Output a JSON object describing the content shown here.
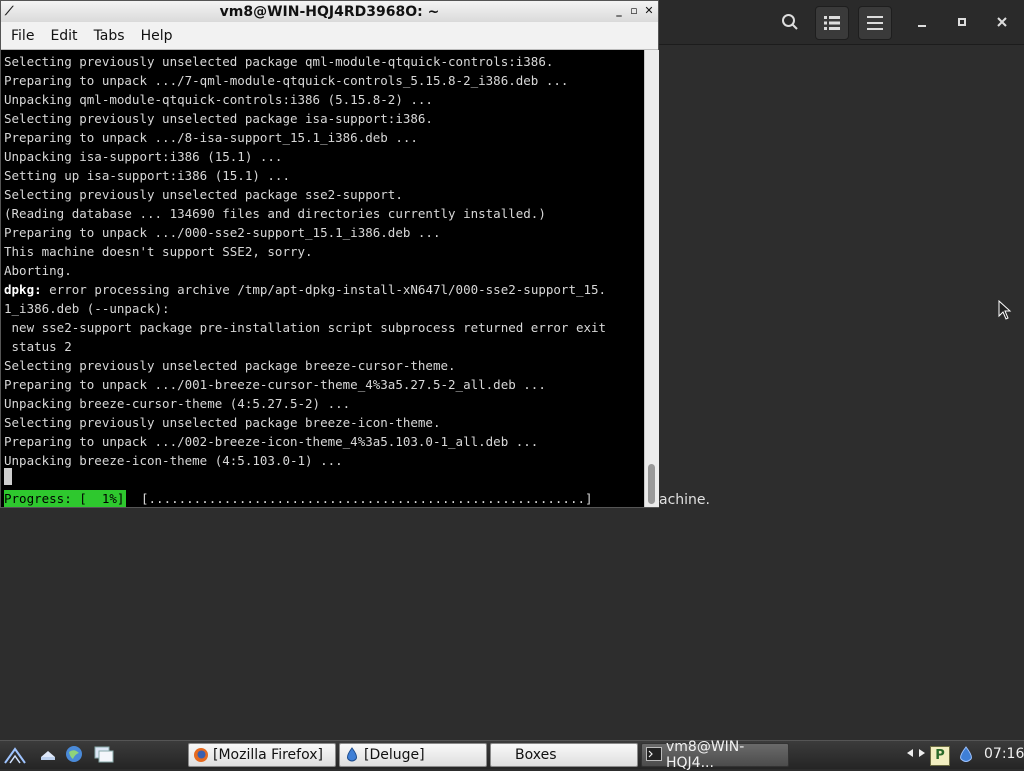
{
  "background_app": {
    "message_tail": "achine.",
    "header_icons": {
      "search": "search-icon",
      "view_list": "list-view-icon",
      "menu": "hamburger-menu-icon",
      "minimize": "minimize-icon",
      "maximize": "maximize-icon",
      "close": "close-icon"
    }
  },
  "terminal": {
    "title": "vm8@WIN-HQJ4RD3968O: ~",
    "window_buttons": {
      "minimize": "_",
      "maximize": "▫",
      "close": "✕"
    },
    "menu": [
      "File",
      "Edit",
      "Tabs",
      "Help"
    ],
    "lines": [
      "Selecting previously unselected package qml-module-qtquick-controls:i386.",
      "Preparing to unpack .../7-qml-module-qtquick-controls_5.15.8-2_i386.deb ...",
      "Unpacking qml-module-qtquick-controls:i386 (5.15.8-2) ...",
      "Selecting previously unselected package isa-support:i386.",
      "Preparing to unpack .../8-isa-support_15.1_i386.deb ...",
      "Unpacking isa-support:i386 (15.1) ...",
      "Setting up isa-support:i386 (15.1) ...",
      "Selecting previously unselected package sse2-support.",
      "(Reading database ... 134690 files and directories currently installed.)",
      "Preparing to unpack .../000-sse2-support_15.1_i386.deb ...",
      "This machine doesn't support SSE2, sorry.",
      "Aborting.",
      "error processing archive /tmp/apt-dpkg-install-xN647l/000-sse2-support_15.",
      "1_i386.deb (--unpack):",
      " new sse2-support package pre-installation script subprocess returned error exit",
      " status 2",
      "Selecting previously unselected package breeze-cursor-theme.",
      "Preparing to unpack .../001-breeze-cursor-theme_4%3a5.27.5-2_all.deb ...",
      "Unpacking breeze-cursor-theme (4:5.27.5-2) ...",
      "Selecting previously unselected package breeze-icon-theme.",
      "Preparing to unpack .../002-breeze-icon-theme_4%3a5.103.0-1_all.deb ...",
      "Unpacking breeze-icon-theme (4:5.103.0-1) ..."
    ],
    "dpkg_prefix": "dpkg:",
    "progress_label": "Progress: [  1%]",
    "progress_percent": 1,
    "progress_bar": "[..........................................................]",
    "colors": {
      "progress_bg": "#2ec82e",
      "terminal_bg": "#000000",
      "text": "#d8d8d8"
    }
  },
  "taskbar": {
    "launchers": [
      "start-menu-icon",
      "show-desktop-icon",
      "web-browser-icon",
      "file-manager-icon"
    ],
    "tasks": [
      {
        "label": "[Mozilla Firefox]",
        "icon": "firefox-icon"
      },
      {
        "label": "[Deluge]",
        "icon": "deluge-icon"
      },
      {
        "label": "Boxes",
        "icon": ""
      },
      {
        "label": "vm8@WIN-HQJ4...",
        "icon": "terminal-icon"
      }
    ],
    "tray": {
      "network": "network-icon",
      "package_updater": "P",
      "deluge_tray": "deluge-tray-icon"
    },
    "clock": "07:16"
  }
}
